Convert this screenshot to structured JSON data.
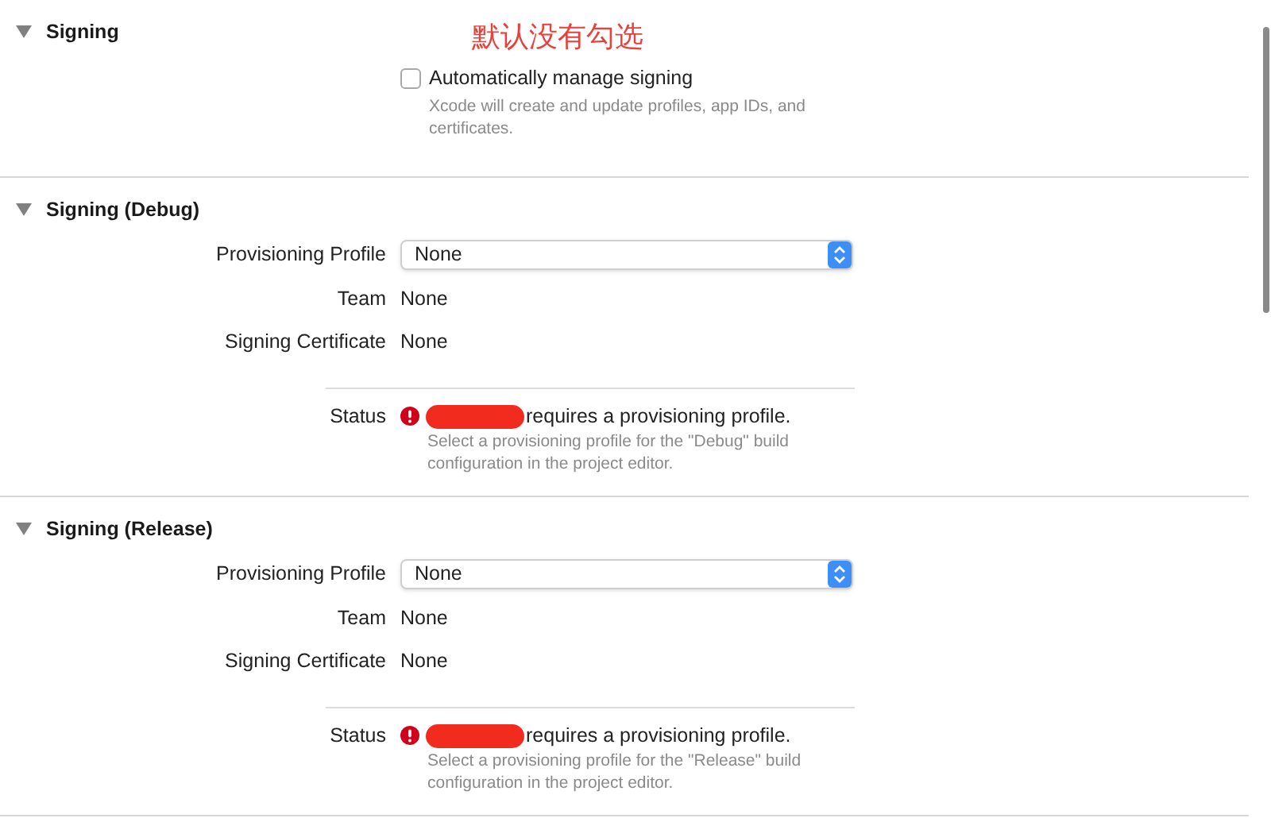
{
  "sections": [
    {
      "title": "Signing",
      "expanded": true,
      "annotation": "默认没有勾选",
      "checkbox": {
        "label": "Automatically manage signing",
        "checked": false,
        "description": "Xcode will create and update profiles, app IDs, and certificates."
      }
    },
    {
      "title": "Signing (Debug)",
      "expanded": true,
      "fields": [
        {
          "kind": "popup",
          "label": "Provisioning Profile",
          "value": "None"
        },
        {
          "kind": "text",
          "label": "Team",
          "value": "None"
        },
        {
          "kind": "text",
          "label": "Signing Certificate",
          "value": "None"
        }
      ],
      "status": {
        "label": "Status",
        "message": "requires a provisioning profile.",
        "detail": "Select a provisioning profile for the \"Debug\" build configuration in the project editor."
      }
    },
    {
      "title": "Signing (Release)",
      "expanded": true,
      "fields": [
        {
          "kind": "popup",
          "label": "Provisioning Profile",
          "value": "None"
        },
        {
          "kind": "text",
          "label": "Team",
          "value": "None"
        },
        {
          "kind": "text",
          "label": "Signing Certificate",
          "value": "None"
        }
      ],
      "status": {
        "label": "Status",
        "message": "requires a provisioning profile.",
        "detail": "Select a provisioning profile for the \"Release\" build configuration in the project editor."
      }
    }
  ]
}
